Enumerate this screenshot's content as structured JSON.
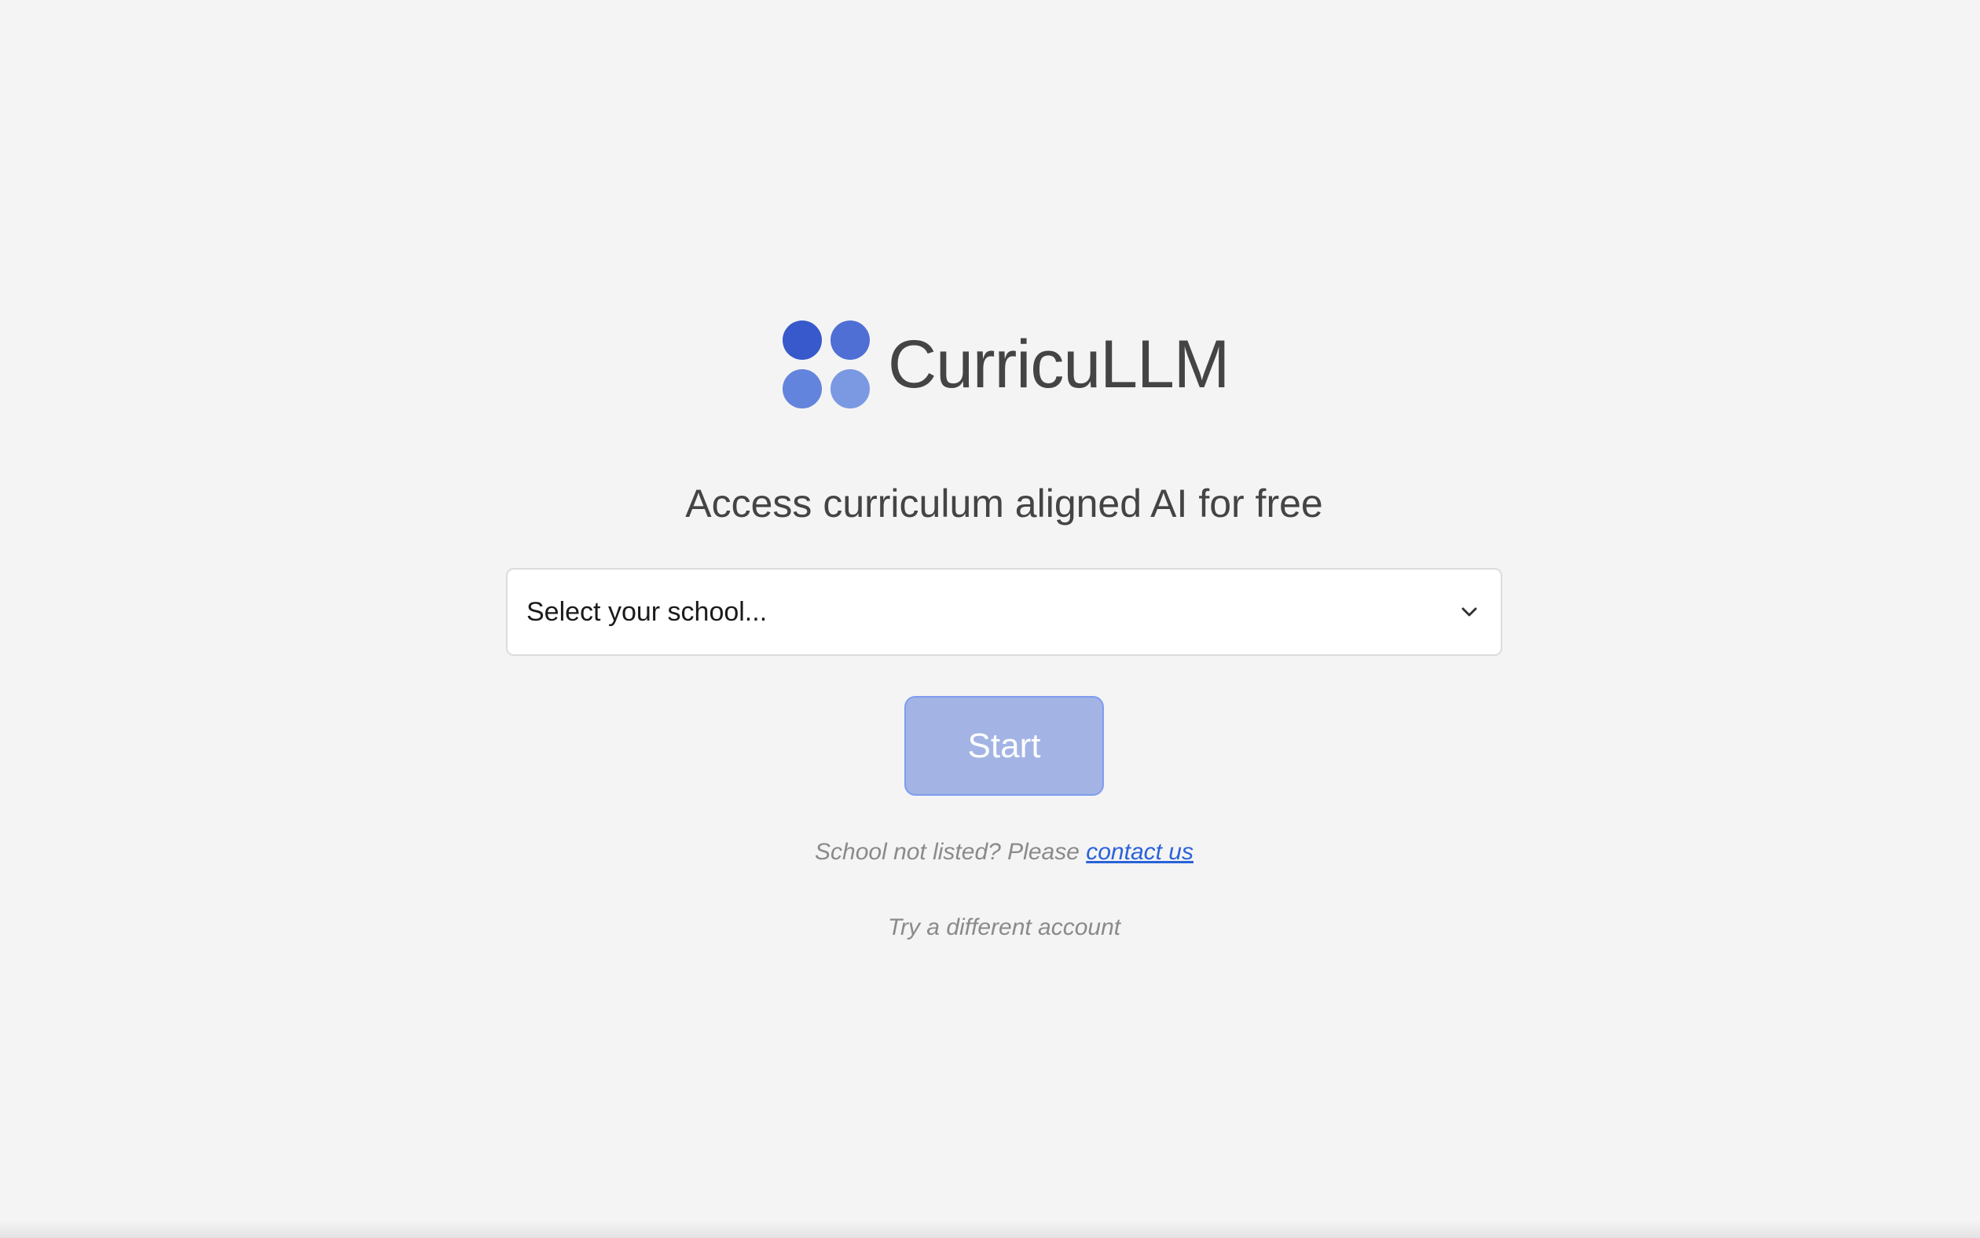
{
  "brand": {
    "name": "CurricuLLM",
    "logo_colors": [
      "#3759cb",
      "#4f6fd4",
      "#6384dc",
      "#7b98e3"
    ]
  },
  "headline": "Access curriculum aligned AI for free",
  "school_select": {
    "value": "Select your school...",
    "icon": "chevron-down-icon"
  },
  "start_button": {
    "label": "Start",
    "state": "disabled",
    "color": "#a3b4e4"
  },
  "not_listed": {
    "text": "School not listed? Please ",
    "link_label": "contact us",
    "link_color": "#2a62d8"
  },
  "different_account": "Try a different account"
}
